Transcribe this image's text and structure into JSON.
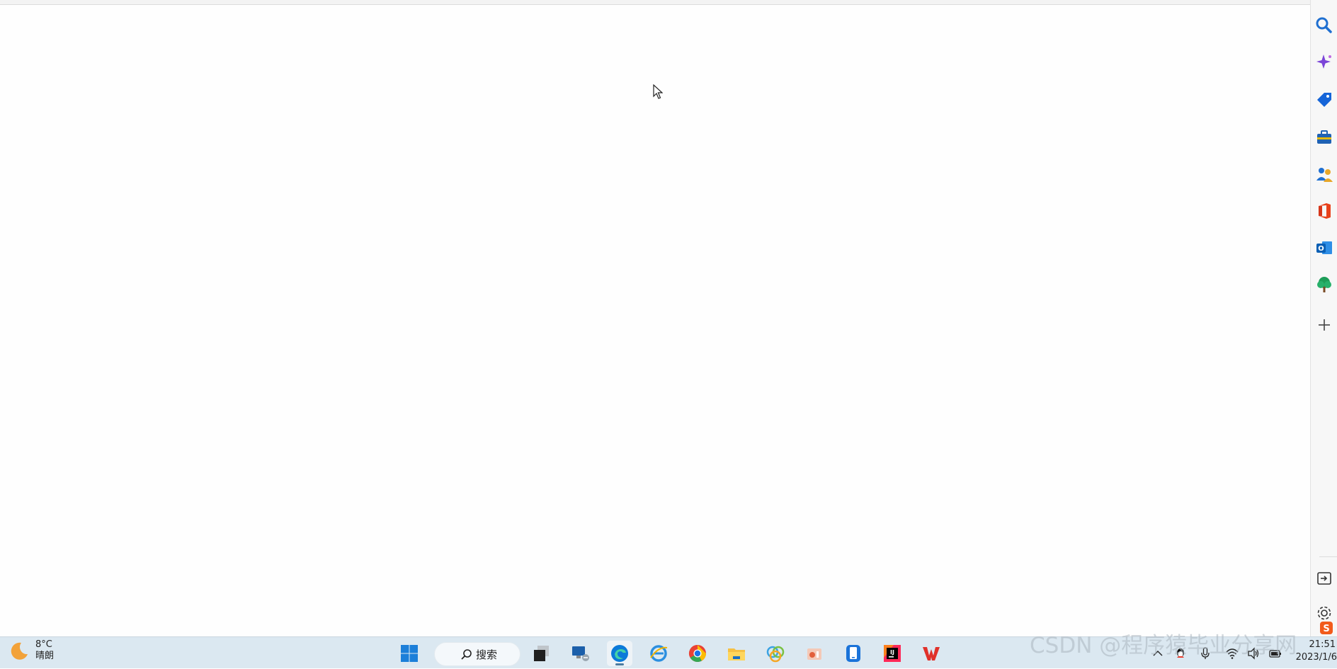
{
  "weather": {
    "temperature": "8°C",
    "condition": "晴朗"
  },
  "taskbar": {
    "search_label": "搜索",
    "apps": [
      {
        "name": "start",
        "icon": "windows-start-icon"
      },
      {
        "name": "task-view",
        "icon": "task-view-icon"
      },
      {
        "name": "remote-desktop",
        "icon": "remote-desktop-icon"
      },
      {
        "name": "edge",
        "icon": "edge-icon",
        "active": true
      },
      {
        "name": "ie",
        "icon": "ie-icon"
      },
      {
        "name": "chrome",
        "icon": "chrome-icon"
      },
      {
        "name": "file-explorer",
        "icon": "folder-icon"
      },
      {
        "name": "photos",
        "icon": "photos-icon"
      },
      {
        "name": "powerpoint",
        "icon": "ppt-icon"
      },
      {
        "name": "phone-link",
        "icon": "phone-link-icon"
      },
      {
        "name": "jetbrains",
        "icon": "intellij-icon"
      },
      {
        "name": "wps",
        "icon": "wps-icon"
      }
    ]
  },
  "tray": {
    "icons": [
      "chevron-up-icon",
      "qq-icon",
      "microphone-icon",
      "wifi-icon",
      "speaker-icon",
      "battery-icon"
    ]
  },
  "clock": {
    "time": "21:51",
    "date": "2023/1/6"
  },
  "sidebar": {
    "items": [
      "search-icon",
      "sparkle-icon",
      "tag-icon",
      "toolbox-icon",
      "people-icon",
      "office-icon",
      "outlook-icon",
      "tree-icon",
      "plus-icon"
    ],
    "bottom_items": [
      "hide-sidebar-icon",
      "settings-icon"
    ]
  },
  "watermark": "CSDN @程序猿毕业分享网",
  "colors": {
    "taskbar_bg": "#dbe8f1",
    "edge_blue": "#0c7ad9",
    "wps_red": "#e0312a"
  }
}
